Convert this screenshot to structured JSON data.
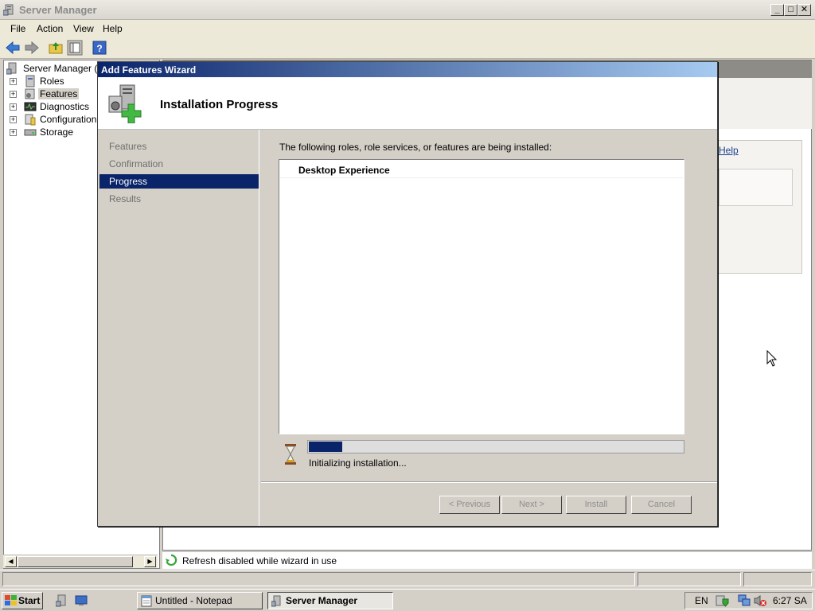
{
  "window": {
    "title": "Server Manager"
  },
  "menu": [
    "File",
    "Action",
    "View",
    "Help"
  ],
  "tree": {
    "root": "Server Manager (W",
    "items": [
      "Roles",
      "Features",
      "Diagnostics",
      "Configuration",
      "Storage"
    ],
    "selected": "Features"
  },
  "right_pane": {
    "help_link": "Help"
  },
  "status": {
    "refresh_text": "Refresh disabled while wizard in use"
  },
  "dialog": {
    "title": "Add Features Wizard",
    "header_title": "Installation Progress",
    "nav": [
      "Features",
      "Confirmation",
      "Progress",
      "Results"
    ],
    "nav_active": "Progress",
    "intro": "The following roles, role services, or features are being installed:",
    "feature": "Desktop Experience",
    "progress_text": "Initializing installation...",
    "progress_fraction": 0.09,
    "buttons": {
      "previous": "< Previous",
      "next": "Next >",
      "install": "Install",
      "cancel": "Cancel"
    }
  },
  "taskbar": {
    "start": "Start",
    "tasks": [
      "Untitled - Notepad",
      "Server Manager"
    ],
    "active_task": "Server Manager",
    "lang": "EN",
    "clock": "6:27 SA"
  }
}
